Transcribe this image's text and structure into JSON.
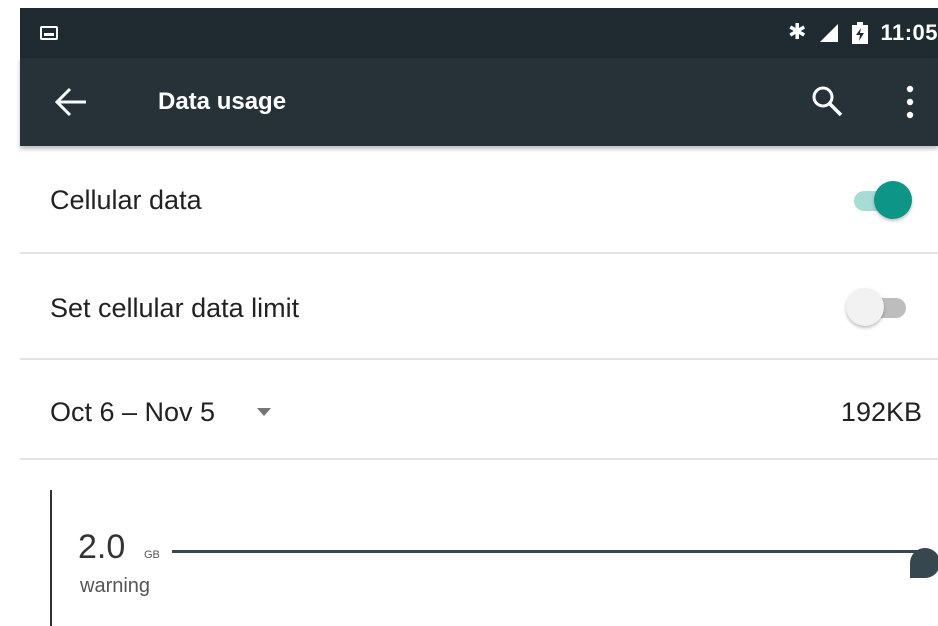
{
  "status_bar": {
    "time": "11:05",
    "icons": [
      "notification-image-icon",
      "bluetooth-icon",
      "signal-icon",
      "battery-charging-icon"
    ]
  },
  "app_bar": {
    "title": "Data usage",
    "icons": [
      "back-arrow-icon",
      "search-icon",
      "overflow-menu-icon"
    ]
  },
  "settings": {
    "cellular_data": {
      "label": "Cellular data",
      "enabled": true
    },
    "data_limit": {
      "label": "Set cellular data limit",
      "enabled": false
    },
    "cycle": {
      "label": "Oct 6 – Nov 5",
      "usage": "192KB"
    }
  },
  "warning": {
    "value": "2.0",
    "unit": "GB",
    "label": "warning"
  },
  "colors": {
    "status_bar": "#1f2b31",
    "app_bar": "#263238",
    "accent": "#0d9688",
    "accent_track": "#a7dbd6",
    "warning_line": "#37474f"
  }
}
